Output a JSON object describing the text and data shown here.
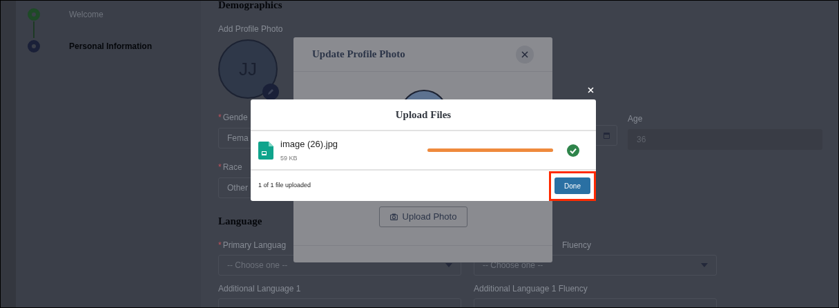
{
  "sidebar": {
    "steps": [
      {
        "label": "Welcome",
        "selected": false
      },
      {
        "label": "Personal Information",
        "selected": true
      }
    ]
  },
  "form": {
    "heading": "Demographics",
    "photo_label": "Add Profile Photo",
    "initials": "JJ",
    "gender": {
      "label": "Gende",
      "required_mark": "*",
      "value": "Fema"
    },
    "age": {
      "label": "Age",
      "value": "36",
      "disabled": true
    },
    "race": {
      "label": "Race",
      "required_mark": "*",
      "value": "Other"
    },
    "language_heading": "Language",
    "primary_language": {
      "label": "Primary Languag",
      "required_mark": "*",
      "placeholder": "-- Choose one --"
    },
    "primary_fluency": {
      "label": "Fluency",
      "placeholder": "-- Choose one --"
    },
    "additional_language": {
      "label": "Additional Language 1"
    },
    "additional_fluency": {
      "label": "Additional Language 1 Fluency"
    }
  },
  "photo_modal": {
    "title": "Update Profile Photo",
    "button": "Upload Photo"
  },
  "upload_dialog": {
    "title": "Upload Files",
    "files": [
      {
        "name": "image (26).jpg",
        "size": "59 KB",
        "level": 1.0,
        "done": true
      }
    ],
    "status": "1 of 1 file uploaded",
    "button": "Done",
    "highlighted": true
  }
}
